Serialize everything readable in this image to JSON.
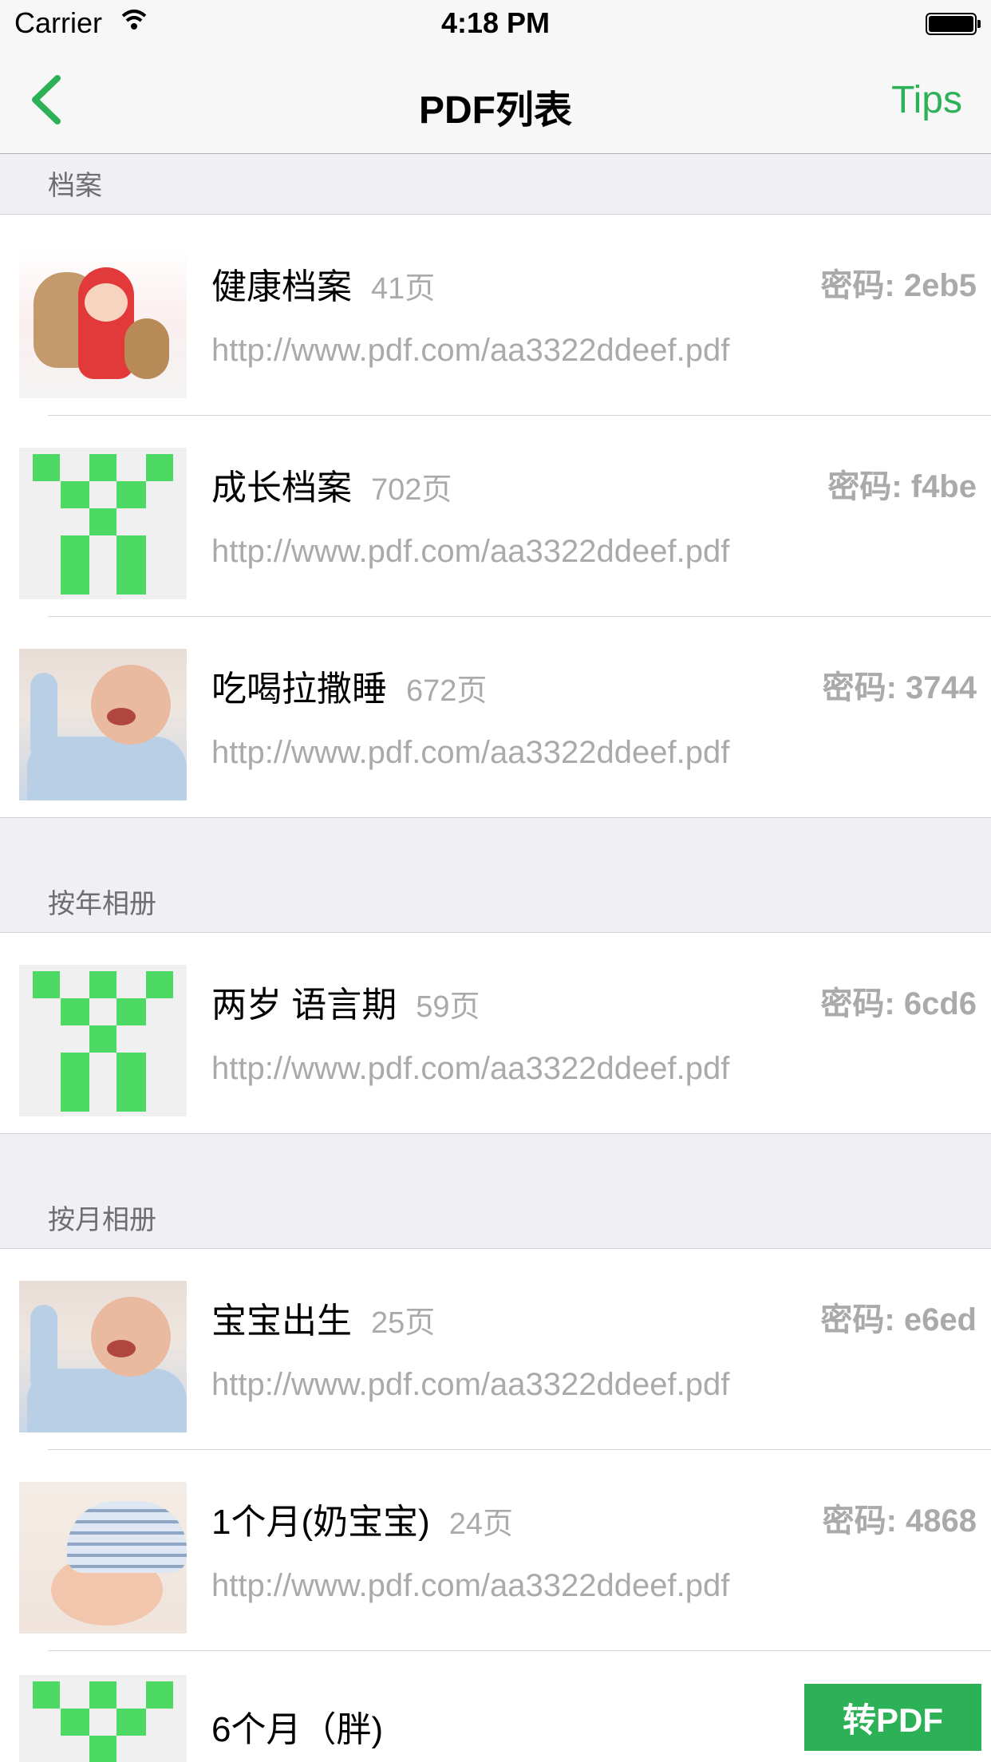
{
  "status_bar": {
    "carrier": "Carrier",
    "time": "4:18 PM"
  },
  "nav": {
    "title": "PDF列表",
    "tips_label": "Tips"
  },
  "sections": [
    {
      "header": "档案",
      "items": [
        {
          "name": "健康档案",
          "pages": "41页",
          "password": "密码: 2eb5",
          "url": "http://www.pdf.com/aa3322ddeef.pdf",
          "thumb": "teddy-baby-photo"
        },
        {
          "name": "成长档案",
          "pages": "702页",
          "password": "密码: f4be",
          "url": "http://www.pdf.com/aa3322ddeef.pdf",
          "thumb": "green-pixel-placeholder"
        },
        {
          "name": "吃喝拉撒睡",
          "pages": "672页",
          "password": "密码: 3744",
          "url": "http://www.pdf.com/aa3322ddeef.pdf",
          "thumb": "crying-baby-photo"
        }
      ]
    },
    {
      "header": "按年相册",
      "items": [
        {
          "name": "两岁 语言期",
          "pages": "59页",
          "password": "密码: 6cd6",
          "url": "http://www.pdf.com/aa3322ddeef.pdf",
          "thumb": "green-pixel-placeholder"
        }
      ]
    },
    {
      "header": "按月相册",
      "items": [
        {
          "name": "宝宝出生",
          "pages": "25页",
          "password": "密码: e6ed",
          "url": "http://www.pdf.com/aa3322ddeef.pdf",
          "thumb": "crying-baby-photo"
        },
        {
          "name": "1个月(奶宝宝)",
          "pages": "24页",
          "password": "密码: 4868",
          "url": "http://www.pdf.com/aa3322ddeef.pdf",
          "thumb": "sleeping-baby-photo"
        },
        {
          "name": "6个月（胖)",
          "pages": "",
          "password": "",
          "url": "",
          "thumb": "green-pixel-placeholder"
        }
      ]
    }
  ],
  "convert_button_label": "转PDF",
  "colors": {
    "accent": "#2db157",
    "pixel_green": "#4cd964"
  }
}
